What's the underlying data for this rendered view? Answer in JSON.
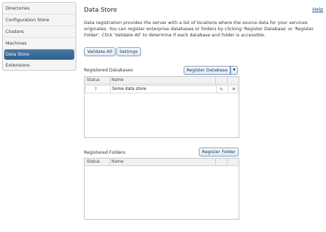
{
  "sidebar": {
    "items": [
      {
        "label": "Directories"
      },
      {
        "label": "Configuration Store"
      },
      {
        "label": "Clusters"
      },
      {
        "label": "Machines"
      },
      {
        "label": "Data Store",
        "active": true
      },
      {
        "label": "Extensions"
      }
    ]
  },
  "header": {
    "title": "Data Store",
    "help": "Help"
  },
  "description": "Data registration provides the server with a list of locations where the source data for your services originates. You can register enterprise databases or folders by clicking 'Register Database' or 'Register Folder'. Click 'Validate All' to determine if each database and folder is accessible.",
  "toolbar": {
    "validate_all": "Validate All",
    "settings": "Settings"
  },
  "databases": {
    "label": "Registered Databases",
    "register_button": "Register Database",
    "columns": {
      "status": "Status",
      "name": "Name"
    },
    "rows": [
      {
        "status_icon": "question-icon",
        "status_glyph": "?",
        "name": "Some data store"
      }
    ]
  },
  "folders": {
    "label": "Registered Folders",
    "register_button": "Register Folder",
    "columns": {
      "status": "Status",
      "name": "Name"
    },
    "rows": []
  },
  "colors": {
    "active_nav": "#2e5f8c",
    "button_border": "#7a9cc0",
    "warning": "#e39b1c"
  }
}
